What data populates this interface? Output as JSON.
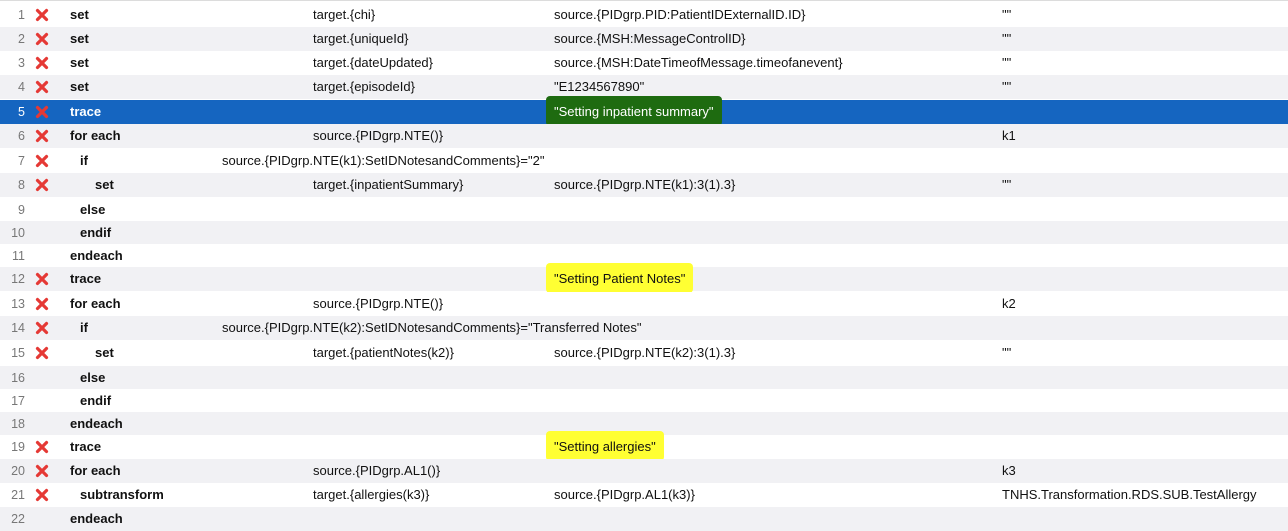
{
  "rows": [
    {
      "num": "1",
      "deletable": true,
      "action": "set",
      "indent": 0,
      "condition": "",
      "property": "target.{chi}",
      "value": "source.{PIDgrp.PID:PatientIDExternalID.ID}",
      "key": "\"\""
    },
    {
      "num": "2",
      "deletable": true,
      "action": "set",
      "indent": 0,
      "condition": "",
      "property": "target.{uniqueId}",
      "value": "source.{MSH:MessageControlID}",
      "key": "\"\""
    },
    {
      "num": "3",
      "deletable": true,
      "action": "set",
      "indent": 0,
      "condition": "",
      "property": "target.{dateUpdated}",
      "value": "source.{MSH:DateTimeofMessage.timeofanevent}",
      "key": "\"\""
    },
    {
      "num": "4",
      "deletable": true,
      "action": "set",
      "indent": 0,
      "condition": "",
      "property": "target.{episodeId}",
      "value": "\"E1234567890\"",
      "key": "\"\""
    },
    {
      "num": "5",
      "deletable": true,
      "action": "trace",
      "indent": 0,
      "condition": "",
      "property": "",
      "value": "\"Setting inpatient summary\"",
      "key": "",
      "selected": true,
      "highlight": "dark"
    },
    {
      "num": "6",
      "deletable": true,
      "action": "for each",
      "indent": 0,
      "condition": "",
      "property": "source.{PIDgrp.NTE()}",
      "value": "",
      "key": "k1"
    },
    {
      "num": "7",
      "deletable": true,
      "action": "if",
      "indent": 1,
      "condition": "source.{PIDgrp.NTE(k1):SetIDNotesandComments}=\"2\"",
      "property": "",
      "value": "",
      "key": ""
    },
    {
      "num": "8",
      "deletable": true,
      "action": "set",
      "indent": 2,
      "condition": "",
      "property": "target.{inpatientSummary}",
      "value": "source.{PIDgrp.NTE(k1):3(1).3}",
      "key": "\"\""
    },
    {
      "num": "9",
      "deletable": false,
      "action": "else",
      "indent": 1,
      "condition": "",
      "property": "",
      "value": "",
      "key": ""
    },
    {
      "num": "10",
      "deletable": false,
      "action": "endif",
      "indent": 1,
      "condition": "",
      "property": "",
      "value": "",
      "key": ""
    },
    {
      "num": "11",
      "deletable": false,
      "action": "endeach",
      "indent": 0,
      "condition": "",
      "property": "",
      "value": "",
      "key": ""
    },
    {
      "num": "12",
      "deletable": true,
      "action": "trace",
      "indent": 0,
      "condition": "",
      "property": "",
      "value": "\"Setting Patient Notes\"",
      "key": "",
      "highlight": "yellow"
    },
    {
      "num": "13",
      "deletable": true,
      "action": "for each",
      "indent": 0,
      "condition": "",
      "property": "source.{PIDgrp.NTE()}",
      "value": "",
      "key": "k2"
    },
    {
      "num": "14",
      "deletable": true,
      "action": "if",
      "indent": 1,
      "condition": "source.{PIDgrp.NTE(k2):SetIDNotesandComments}=\"Transferred Notes\"",
      "property": "",
      "value": "",
      "key": ""
    },
    {
      "num": "15",
      "deletable": true,
      "action": "set",
      "indent": 2,
      "condition": "",
      "property": "target.{patientNotes(k2)}",
      "value": "source.{PIDgrp.NTE(k2):3(1).3}",
      "key": "\"\""
    },
    {
      "num": "16",
      "deletable": false,
      "action": "else",
      "indent": 1,
      "condition": "",
      "property": "",
      "value": "",
      "key": ""
    },
    {
      "num": "17",
      "deletable": false,
      "action": "endif",
      "indent": 1,
      "condition": "",
      "property": "",
      "value": "",
      "key": ""
    },
    {
      "num": "18",
      "deletable": false,
      "action": "endeach",
      "indent": 0,
      "condition": "",
      "property": "",
      "value": "",
      "key": ""
    },
    {
      "num": "19",
      "deletable": true,
      "action": "trace",
      "indent": 0,
      "condition": "",
      "property": "",
      "value": "\"Setting allergies\"",
      "key": "",
      "highlight": "yellow"
    },
    {
      "num": "20",
      "deletable": true,
      "action": "for each",
      "indent": 0,
      "condition": "",
      "property": "source.{PIDgrp.AL1()}",
      "value": "",
      "key": "k3"
    },
    {
      "num": "21",
      "deletable": true,
      "action": "subtransform",
      "indent": 1,
      "condition": "",
      "property": "target.{allergies(k3)}",
      "value": "source.{PIDgrp.AL1(k3)}",
      "key": "TNHS.Transformation.RDS.SUB.TestAllergy"
    },
    {
      "num": "22",
      "deletable": false,
      "action": "endeach",
      "indent": 0,
      "condition": "",
      "property": "",
      "value": "",
      "key": ""
    }
  ],
  "icons": {
    "delete": "delete-x-icon"
  },
  "colors": {
    "selected_row": "#1565c0",
    "highlight_yellow": "#ffff33",
    "highlight_dark": "#1e6b10",
    "delete_icon": "#e53935"
  }
}
